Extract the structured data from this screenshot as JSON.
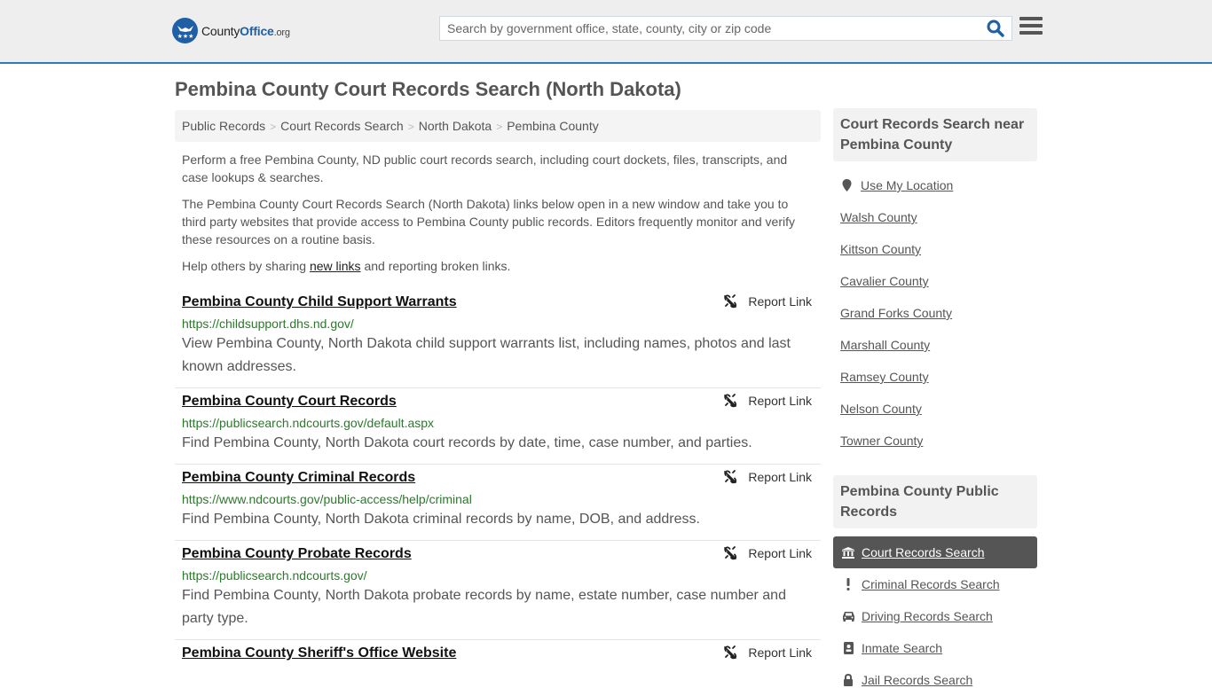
{
  "header": {
    "logo_county": "County",
    "logo_office": "Office",
    "logo_org": ".org",
    "search_placeholder": "Search by government office, state, county, city or zip code",
    "search_value": ""
  },
  "page": {
    "title": "Pembina County Court Records Search (North Dakota)"
  },
  "breadcrumb": [
    {
      "label": "Public Records"
    },
    {
      "label": "Court Records Search"
    },
    {
      "label": "North Dakota"
    },
    {
      "label": "Pembina County"
    }
  ],
  "intro": {
    "p1": "Perform a free Pembina County, ND public court records search, including court dockets, files, transcripts, and case lookups & searches.",
    "p2": "The Pembina County Court Records Search (North Dakota) links below open in a new window and take you to third party websites that provide access to Pembina County public records. Editors frequently monitor and verify these resources on a routine basis.",
    "p3_before": "Help others by sharing ",
    "p3_link": "new links",
    "p3_after": " and reporting broken links."
  },
  "report_label": "Report Link",
  "results": [
    {
      "title": "Pembina County Child Support Warrants",
      "url": "https://childsupport.dhs.nd.gov/",
      "description": "View Pembina County, North Dakota child support warrants list, including names, photos and last known addresses."
    },
    {
      "title": "Pembina County Court Records",
      "url": "https://publicsearch.ndcourts.gov/default.aspx",
      "description": "Find Pembina County, North Dakota court records by date, time, case number, and parties."
    },
    {
      "title": "Pembina County Criminal Records",
      "url": "https://www.ndcourts.gov/public-access/help/criminal",
      "description": "Find Pembina County, North Dakota criminal records by name, DOB, and address."
    },
    {
      "title": "Pembina County Probate Records",
      "url": "https://publicsearch.ndcourts.gov/",
      "description": "Find Pembina County, North Dakota probate records by name, estate number, case number and party type."
    },
    {
      "title": "Pembina County Sheriff's Office Website",
      "url": "",
      "description": ""
    }
  ],
  "sidebar": {
    "near": {
      "heading": "Court Records Search near Pembina County",
      "use_location": "Use My Location",
      "counties": [
        "Walsh County",
        "Kittson County",
        "Cavalier County",
        "Grand Forks County",
        "Marshall County",
        "Ramsey County",
        "Nelson County",
        "Towner County"
      ]
    },
    "public_records": {
      "heading": "Pembina County Public Records",
      "items": [
        {
          "label": "Court Records Search",
          "icon": "courthouse-icon",
          "active": true
        },
        {
          "label": "Criminal Records Search",
          "icon": "exclamation-icon",
          "active": false
        },
        {
          "label": "Driving Records Search",
          "icon": "car-icon",
          "active": false
        },
        {
          "label": "Inmate Search",
          "icon": "id-badge-icon",
          "active": false
        },
        {
          "label": "Jail Records Search",
          "icon": "lock-icon",
          "active": false
        }
      ]
    }
  },
  "colors": {
    "brand_blue": "#1f5fa6",
    "header_border": "#2f7bb8",
    "url_green": "#2a7a2a",
    "active_item_bg": "#555555"
  }
}
